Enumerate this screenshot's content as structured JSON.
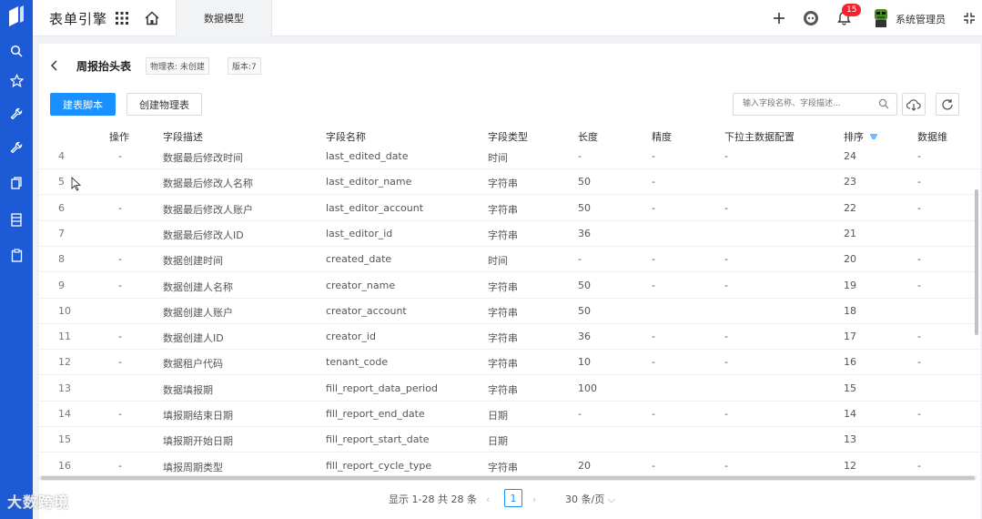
{
  "app": {
    "title": "表单引擎"
  },
  "topbar": {
    "active_tab": "数据模型",
    "notification_count": "15",
    "user_name": "系统管理员"
  },
  "page": {
    "title": "周报抬头表",
    "physical_table_tag": "物理表: 未创建",
    "version_tag": "版本:7"
  },
  "toolbar": {
    "build_script_label": "建表脚本",
    "create_physical_table_label": "创建物理表",
    "search_placeholder": "输入字段名称、字段描述..."
  },
  "table": {
    "columns": [
      "操作",
      "字段描述",
      "字段名称",
      "字段类型",
      "长度",
      "精度",
      "下拉主数据配置",
      "排序",
      "数据维"
    ],
    "rows": [
      {
        "idx": "4",
        "op": "-",
        "desc": "数据最后修改时间",
        "name": "last_edited_date",
        "type": "时间",
        "len": "-",
        "prec": "-",
        "dropdown": "-",
        "sort": "24",
        "dim": "-"
      },
      {
        "idx": "5",
        "op": "",
        "desc": "数据最后修改人名称",
        "name": "last_editor_name",
        "type": "字符串",
        "len": "50",
        "prec": "-",
        "dropdown": "",
        "sort": "23",
        "dim": "-"
      },
      {
        "idx": "6",
        "op": "-",
        "desc": "数据最后修改人账户",
        "name": "last_editor_account",
        "type": "字符串",
        "len": "50",
        "prec": "-",
        "dropdown": "-",
        "sort": "22",
        "dim": "-"
      },
      {
        "idx": "7",
        "op": "",
        "desc": "数据最后修改人ID",
        "name": "last_editor_id",
        "type": "字符串",
        "len": "36",
        "prec": "",
        "dropdown": "",
        "sort": "21",
        "dim": ""
      },
      {
        "idx": "8",
        "op": "-",
        "desc": "数据创建时间",
        "name": "created_date",
        "type": "时间",
        "len": "-",
        "prec": "-",
        "dropdown": "-",
        "sort": "20",
        "dim": "-"
      },
      {
        "idx": "9",
        "op": "-",
        "desc": "数据创建人名称",
        "name": "creator_name",
        "type": "字符串",
        "len": "50",
        "prec": "-",
        "dropdown": "-",
        "sort": "19",
        "dim": "-"
      },
      {
        "idx": "10",
        "op": "",
        "desc": "数据创建人账户",
        "name": "creator_account",
        "type": "字符串",
        "len": "50",
        "prec": "",
        "dropdown": "",
        "sort": "18",
        "dim": ""
      },
      {
        "idx": "11",
        "op": "-",
        "desc": "数据创建人ID",
        "name": "creator_id",
        "type": "字符串",
        "len": "36",
        "prec": "-",
        "dropdown": "-",
        "sort": "17",
        "dim": "-"
      },
      {
        "idx": "12",
        "op": "-",
        "desc": "数据租户代码",
        "name": "tenant_code",
        "type": "字符串",
        "len": "10",
        "prec": "-",
        "dropdown": "-",
        "sort": "16",
        "dim": "-"
      },
      {
        "idx": "13",
        "op": "",
        "desc": "数据填报期",
        "name": "fill_report_data_period",
        "type": "字符串",
        "len": "100",
        "prec": "",
        "dropdown": "",
        "sort": "15",
        "dim": ""
      },
      {
        "idx": "14",
        "op": "-",
        "desc": "填报期结束日期",
        "name": "fill_report_end_date",
        "type": "日期",
        "len": "-",
        "prec": "-",
        "dropdown": "-",
        "sort": "14",
        "dim": "-"
      },
      {
        "idx": "15",
        "op": "",
        "desc": "填报期开始日期",
        "name": "fill_report_start_date",
        "type": "日期",
        "len": "",
        "prec": "",
        "dropdown": "",
        "sort": "13",
        "dim": ""
      },
      {
        "idx": "16",
        "op": "-",
        "desc": "填报周期类型",
        "name": "fill_report_cycle_type",
        "type": "字符串",
        "len": "20",
        "prec": "-",
        "dropdown": "-",
        "sort": "12",
        "dim": "-"
      }
    ]
  },
  "pagination": {
    "summary": "显示 1-28 共 28 条",
    "current_page": "1",
    "page_size": "30 条/页"
  },
  "watermark": "大数跨境",
  "colors": {
    "rail": "#1d5bd6",
    "primary": "#1890ff",
    "badge": "#f5222d"
  }
}
